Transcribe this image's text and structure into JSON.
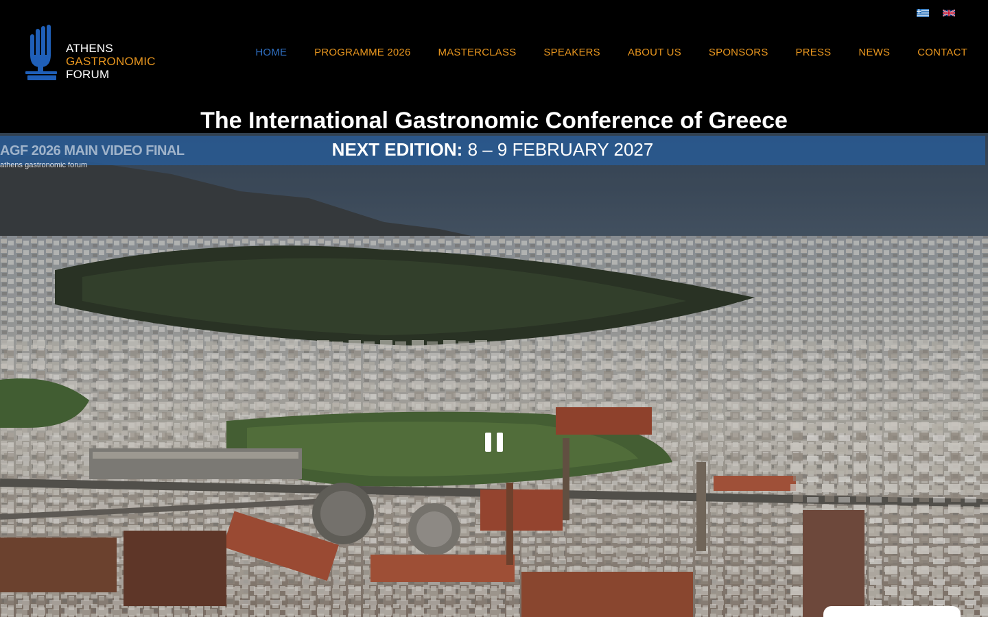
{
  "language_switch": [
    {
      "name": "greek-flag-icon",
      "code": "el"
    },
    {
      "name": "uk-flag-icon",
      "code": "en"
    }
  ],
  "logo": {
    "line1": "ATHENS",
    "line2": "GASTRONOMIC",
    "line3": "FORUM",
    "icon": "hand-fork-icon",
    "colors": {
      "icon": "#1f5fb8",
      "accent": "#e8961f"
    }
  },
  "nav": {
    "items": [
      {
        "label": "HOME",
        "active": true
      },
      {
        "label": "PROGRAMME 2026"
      },
      {
        "label": "MASTERCLASS"
      },
      {
        "label": "SPEAKERS"
      },
      {
        "label": "ABOUT US"
      },
      {
        "label": "SPONSORS"
      },
      {
        "label": "PRESS"
      },
      {
        "label": "NEWS"
      },
      {
        "label": "CONTACT"
      }
    ],
    "colors": {
      "default": "#e8961f",
      "active": "#2f6fc2"
    }
  },
  "hero": {
    "title": "The International Gastronomic Conference of Greece",
    "edition_label": "NEXT EDITION:",
    "edition_dates": " 8 – 9 FEBRUARY 2027",
    "band_color": "#285c96"
  },
  "video": {
    "title": "AGF 2026 MAIN VIDEO FINAL",
    "channel": "athens gastronomic forum",
    "control_icon": "pause-icon"
  }
}
